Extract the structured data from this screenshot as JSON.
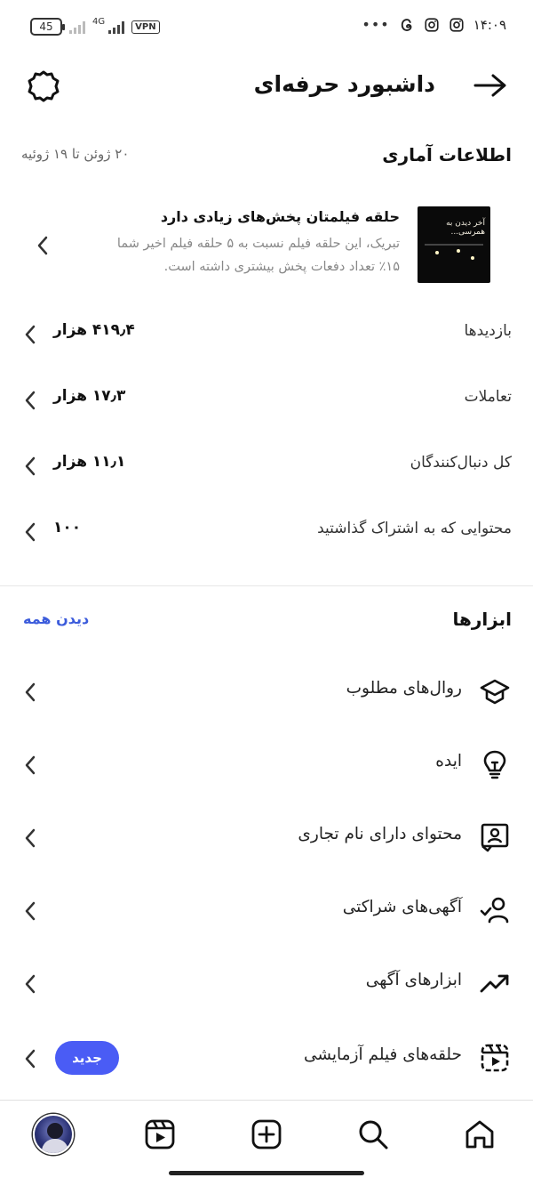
{
  "status_bar": {
    "battery": "45",
    "network": "4G",
    "vpn": "VPN",
    "dots": "•••",
    "time": "۱۴:۰۹"
  },
  "header": {
    "title": "داشبورد حرفه‌ای"
  },
  "insights": {
    "title": "اطلاعات آماری",
    "date_range": "۲۰ ژوئن تا ۱۹ ژوئیه",
    "reel": {
      "title": "حلقه فیلمتان پخش‌های زیادی دارد",
      "description": "تبریک، این حلقه فیلم نسبت به ۵ حلقه فیلم اخیر شما ۱۵٪ تعداد دفعات پخش بیشتری داشته است.",
      "thumbnail_text": "آخر دیدن به همرسی..."
    },
    "stats": [
      {
        "label": "بازدیدها",
        "value": "۴۱۹٫۴ هزار"
      },
      {
        "label": "تعاملات",
        "value": "۱۷٫۳ هزار"
      },
      {
        "label": "کل دنبال‌کنندگان",
        "value": "۱۱٫۱ هزار"
      },
      {
        "label": "محتوایی که به اشتراک گذاشتید",
        "value": "۱۰۰"
      }
    ]
  },
  "tools": {
    "title": "ابزارها",
    "see_all": "دیدن همه",
    "items": [
      {
        "label": "روال‌های مطلوب",
        "icon": "graduation-cap-icon"
      },
      {
        "label": "ایده",
        "icon": "lightbulb-icon"
      },
      {
        "label": "محتوای دارای نام تجاری",
        "icon": "branded-content-icon"
      },
      {
        "label": "آگهی‌های شراکتی",
        "icon": "partnership-ads-icon"
      },
      {
        "label": "ابزارهای آگهی",
        "icon": "trending-up-icon"
      },
      {
        "label": "حلقه‌های فیلم آزمایشی",
        "icon": "trial-reels-icon",
        "badge": "جدید"
      }
    ]
  },
  "colors": {
    "accent": "#4a5cf5",
    "link": "#3b5bdb"
  }
}
